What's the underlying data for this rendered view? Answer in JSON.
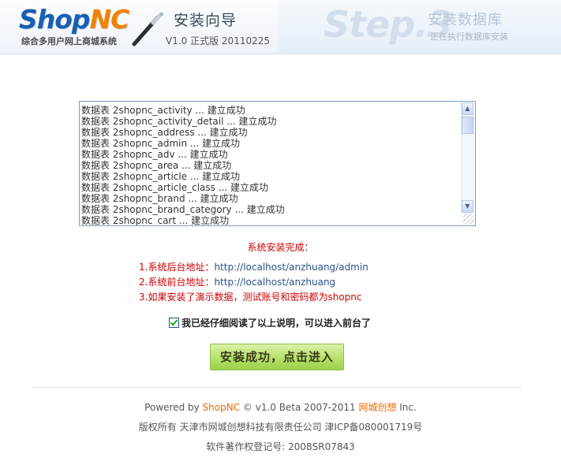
{
  "header": {
    "logo_shop": "Shop",
    "logo_nc": "NC",
    "logo_subtitle": "综合多用户网上商城系统",
    "wizard_title": "安装向导",
    "version": "V1.0 正式版 20110225",
    "step_label": "Step.3",
    "step_title": "安装数据库",
    "step_subtitle": "正在执行数据库安装"
  },
  "log": [
    "数据表 2shopnc_activity ... 建立成功",
    "数据表 2shopnc_activity_detail ... 建立成功",
    "数据表 2shopnc_address ... 建立成功",
    "数据表 2shopnc_admin ... 建立成功",
    "数据表 2shopnc_adv ... 建立成功",
    "数据表 2shopnc_area ... 建立成功",
    "数据表 2shopnc_article ... 建立成功",
    "数据表 2shopnc_article_class ... 建立成功",
    "数据表 2shopnc_brand ... 建立成功",
    "数据表 2shopnc_brand_category ... 建立成功",
    "数据表 2shopnc_cart ... 建立成功"
  ],
  "complete": {
    "title": "系统安装完成：",
    "admin_label": "1.系统后台地址：",
    "admin_url": "http://localhost/anzhuang/admin",
    "front_label": "2.系统前台地址：",
    "front_url": "http://localhost/anzhuang",
    "demo_note": "3.如果安装了演示数据，测试账号和密码都为shopnc"
  },
  "agree": {
    "label": "我已经仔细阅读了以上说明，可以进入前台了",
    "checked": true
  },
  "enter_button": "安装成功，点击进入",
  "footer": {
    "powered_prefix": "Powered by ",
    "powered_brand": "ShopNC",
    "powered_middle": " © v1.0 Beta 2007-2011 ",
    "powered_company": "网城创想",
    "powered_suffix": " Inc.",
    "copyright": "版权所有 天津市网城创想科技有限责任公司 津ICP备080001719号",
    "software_reg": "软件著作权登记号: 2008SR07843"
  }
}
